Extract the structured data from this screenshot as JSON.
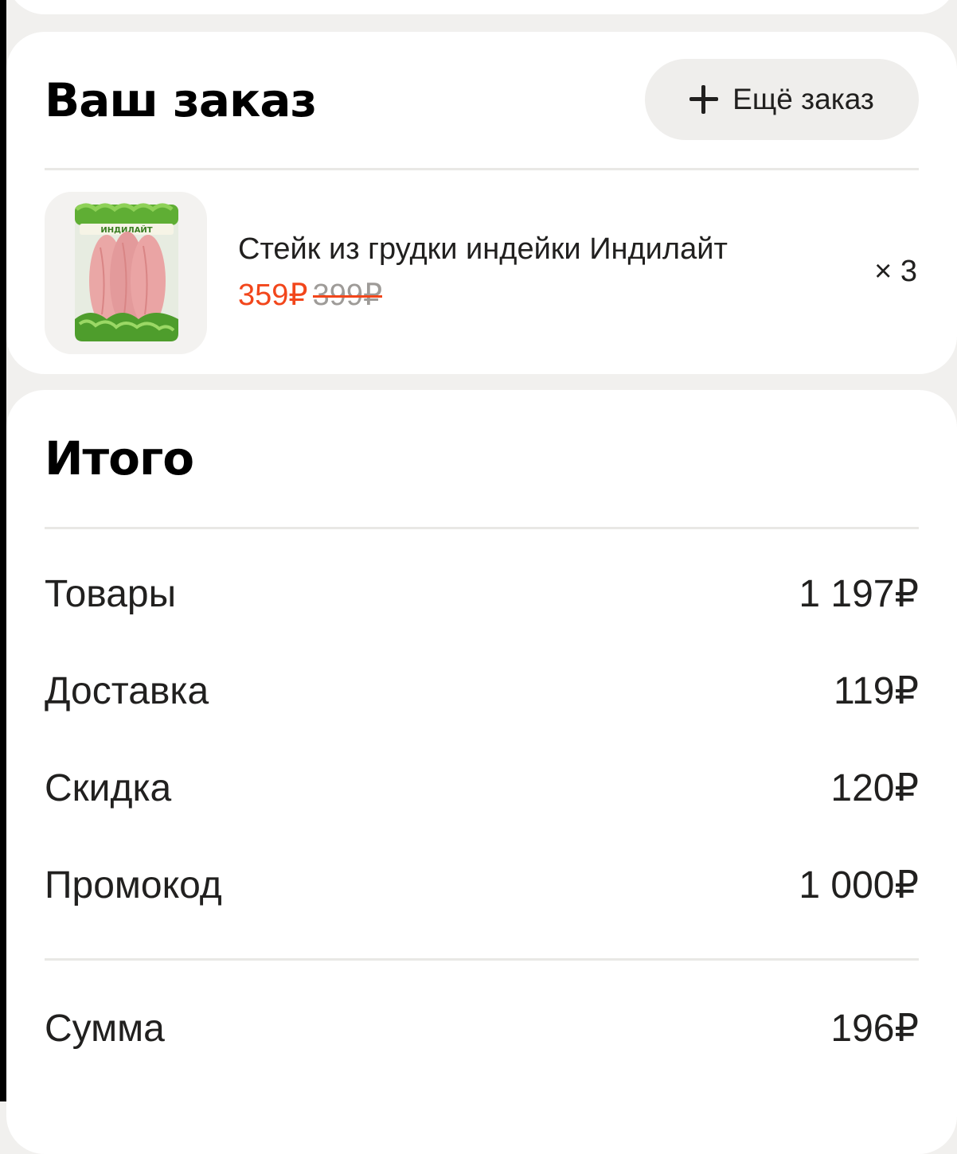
{
  "order": {
    "title": "Ваш заказ",
    "add_button_label": "Ещё заказ",
    "item": {
      "name": "Стейк из грудки индейки Индилайт",
      "price": "359₽",
      "old_price": "399₽",
      "quantity": "× 3",
      "brand_label": "ИНДИЛАЙТ"
    }
  },
  "totals": {
    "title": "Итого",
    "rows": [
      {
        "label": "Товары",
        "value": "1 197₽"
      },
      {
        "label": "Доставка",
        "value": "119₽"
      },
      {
        "label": "Скидка",
        "value": "120₽"
      },
      {
        "label": "Промокод",
        "value": "1 000₽"
      }
    ],
    "sum": {
      "label": "Сумма",
      "value": "196₽"
    }
  },
  "colors": {
    "price_accent": "#f2461b",
    "old_price": "#9e9b98",
    "button_bg": "#efeeec"
  }
}
